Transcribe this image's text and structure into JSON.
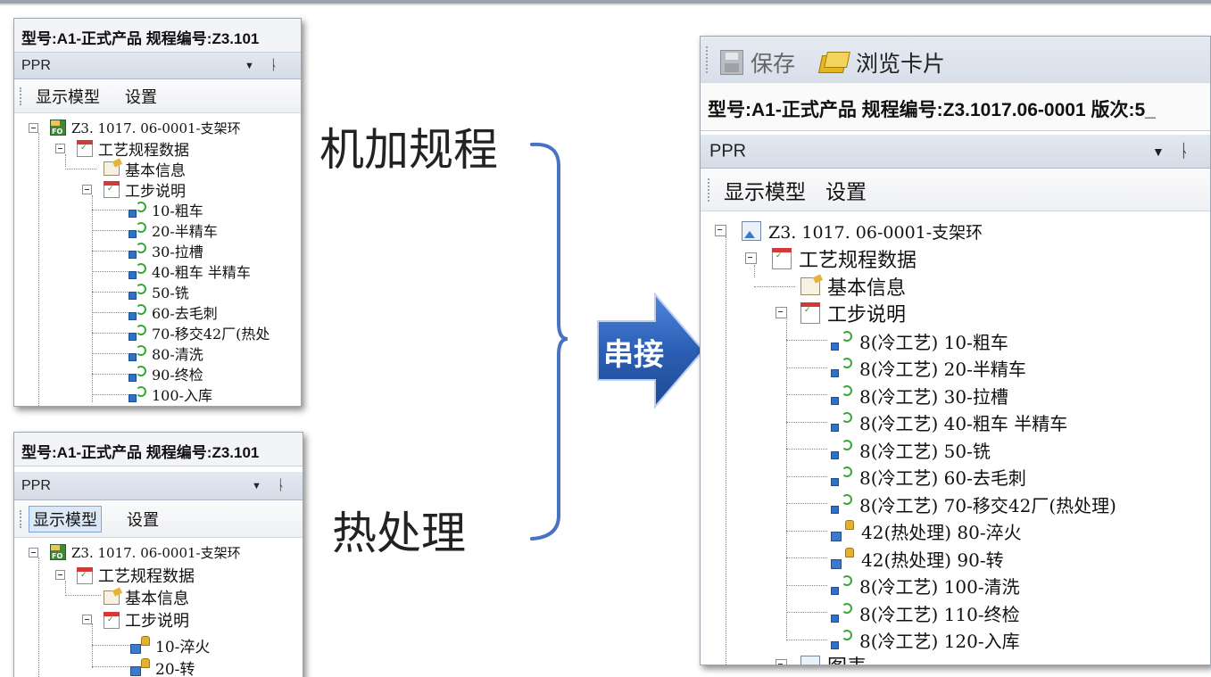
{
  "left_top": {
    "header": "型号:A1-正式产品 规程编号:Z3.101",
    "ppr": "PPR",
    "pin_symbol": "▼",
    "pin2_symbol": "ᚿ",
    "toolbar": [
      "显示模型",
      "设置"
    ],
    "tree": {
      "root": "Z3. 1017. 06-0001-支架环",
      "data": "工艺规程数据",
      "basic": "基本信息",
      "steps_label": "工步说明",
      "steps": [
        "10-粗车",
        "20-半精车",
        "30-拉槽",
        "40-粗车 半精车",
        "50-铣",
        "60-去毛刺",
        "70-移交42厂(热处",
        "80-清洗",
        "90-终检",
        "100-入库"
      ]
    }
  },
  "left_bottom": {
    "header": "型号:A1-正式产品 规程编号:Z3.101",
    "ppr": "PPR",
    "pin_symbol": "▼",
    "pin2_symbol": "ᚿ",
    "toolbar": [
      "显示模型",
      "设置"
    ],
    "tree": {
      "root": "Z3. 1017. 06-0001-支架环",
      "data": "工艺规程数据",
      "basic": "基本信息",
      "steps_label": "工步说明",
      "steps": [
        "10-淬火",
        "20-转"
      ]
    }
  },
  "labels": {
    "machining": "机加规程",
    "heat": "热处理",
    "arrow": "串接"
  },
  "right": {
    "toolbar": {
      "save": "保存",
      "browse": "浏览卡片"
    },
    "header": "型号:A1-正式产品 规程编号:Z3.1017.06-0001 版次:5_",
    "ppr": "PPR",
    "pin_symbol": "▼",
    "pin2_symbol": "ᚿ",
    "subtoolbar": [
      "显示模型",
      "设置"
    ],
    "tree": {
      "root": "Z3. 1017. 06-0001-支架环",
      "data": "工艺规程数据",
      "basic": "基本信息",
      "steps_label": "工步说明",
      "steps": [
        {
          "text": "8(冷工艺) 10-粗车",
          "icon": "cold"
        },
        {
          "text": "8(冷工艺) 20-半精车",
          "icon": "cold"
        },
        {
          "text": "8(冷工艺) 30-拉槽",
          "icon": "cold"
        },
        {
          "text": "8(冷工艺) 40-粗车 半精车",
          "icon": "cold"
        },
        {
          "text": "8(冷工艺) 50-铣",
          "icon": "cold"
        },
        {
          "text": "8(冷工艺) 60-去毛刺",
          "icon": "cold"
        },
        {
          "text": "8(冷工艺) 70-移交42厂(热处理)",
          "icon": "cold"
        },
        {
          "text": "42(热处理) 80-淬火",
          "icon": "heat"
        },
        {
          "text": "42(热处理) 90-转",
          "icon": "heat"
        },
        {
          "text": "8(冷工艺) 100-清洗",
          "icon": "cold"
        },
        {
          "text": "8(冷工艺) 110-终检",
          "icon": "cold"
        },
        {
          "text": "8(冷工艺) 120-入库",
          "icon": "cold"
        }
      ],
      "next": "图表"
    }
  },
  "colors": {
    "arrow": "#2b5fb5",
    "bracket": "#4a72c4"
  }
}
